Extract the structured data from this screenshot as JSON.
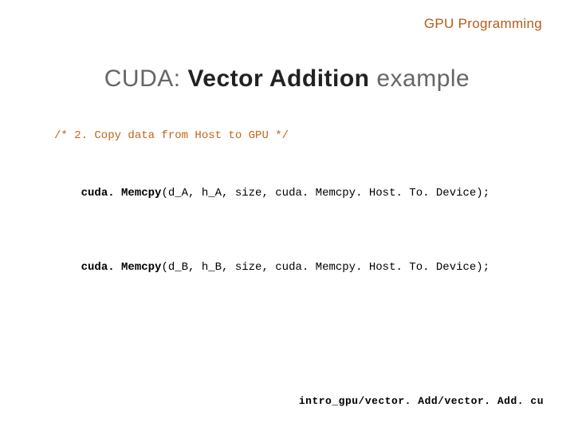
{
  "header": {
    "topic": "GPU Programming"
  },
  "title": {
    "prefix": "CUDA:   ",
    "main": "Vector Addition",
    "suffix": "   example"
  },
  "code": {
    "comment": "/* 2. Copy data from Host to GPU */",
    "line1_fn": "cuda. Memcpy",
    "line1_rest": "(d_A, h_A, size, cuda. Memcpy. Host. To. Device);",
    "line2_fn": "cuda. Memcpy",
    "line2_rest": "(d_B, h_B, size, cuda. Memcpy. Host. To. Device);"
  },
  "footer": {
    "path": "intro_gpu/vector. Add/vector. Add. cu"
  }
}
